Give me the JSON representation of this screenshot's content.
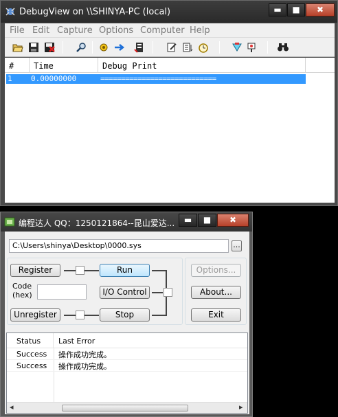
{
  "debugview": {
    "title": "DebugView on \\\\SHINYA-PC (local)",
    "controls": {
      "minimize": "▬",
      "maximize": "■",
      "close": "✖"
    },
    "menu": [
      "File",
      "Edit",
      "Capture",
      "Options",
      "Computer",
      "Help"
    ],
    "toolbar_icons": [
      "open-icon",
      "save-icon",
      "clear-icon",
      "find-icon",
      "capture-icon",
      "autoscroll-icon",
      "history-icon",
      "highlight-icon",
      "filter-icon",
      "clock-icon",
      "bookmark-icon",
      "pin-icon",
      "binoculars-icon"
    ],
    "columns": [
      "#",
      "Time",
      "Debug Print"
    ],
    "rows": [
      {
        "num": "1",
        "time": "0.00000000",
        "print": "============================"
      }
    ]
  },
  "loader": {
    "title": "编程达人 QQ：1250121864--昆山爱达...",
    "driver_path": "C:\\Users\\shinya\\Desktop\\0000.sys",
    "browse_label": "...",
    "register_label": "Register",
    "run_label": "Run",
    "code_label": "Code\n(hex)",
    "io_control_label": "I/O Control",
    "unregister_label": "Unregister",
    "stop_label": "Stop",
    "options_label": "Options...",
    "about_label": "About...",
    "exit_label": "Exit",
    "columns": [
      "Status",
      "Last Error"
    ],
    "rows": [
      {
        "status": "Success",
        "error": "操作成功完成。"
      },
      {
        "status": "Success",
        "error": "操作成功完成。"
      }
    ],
    "scroll_left": "◂",
    "scroll_right": "▸"
  }
}
